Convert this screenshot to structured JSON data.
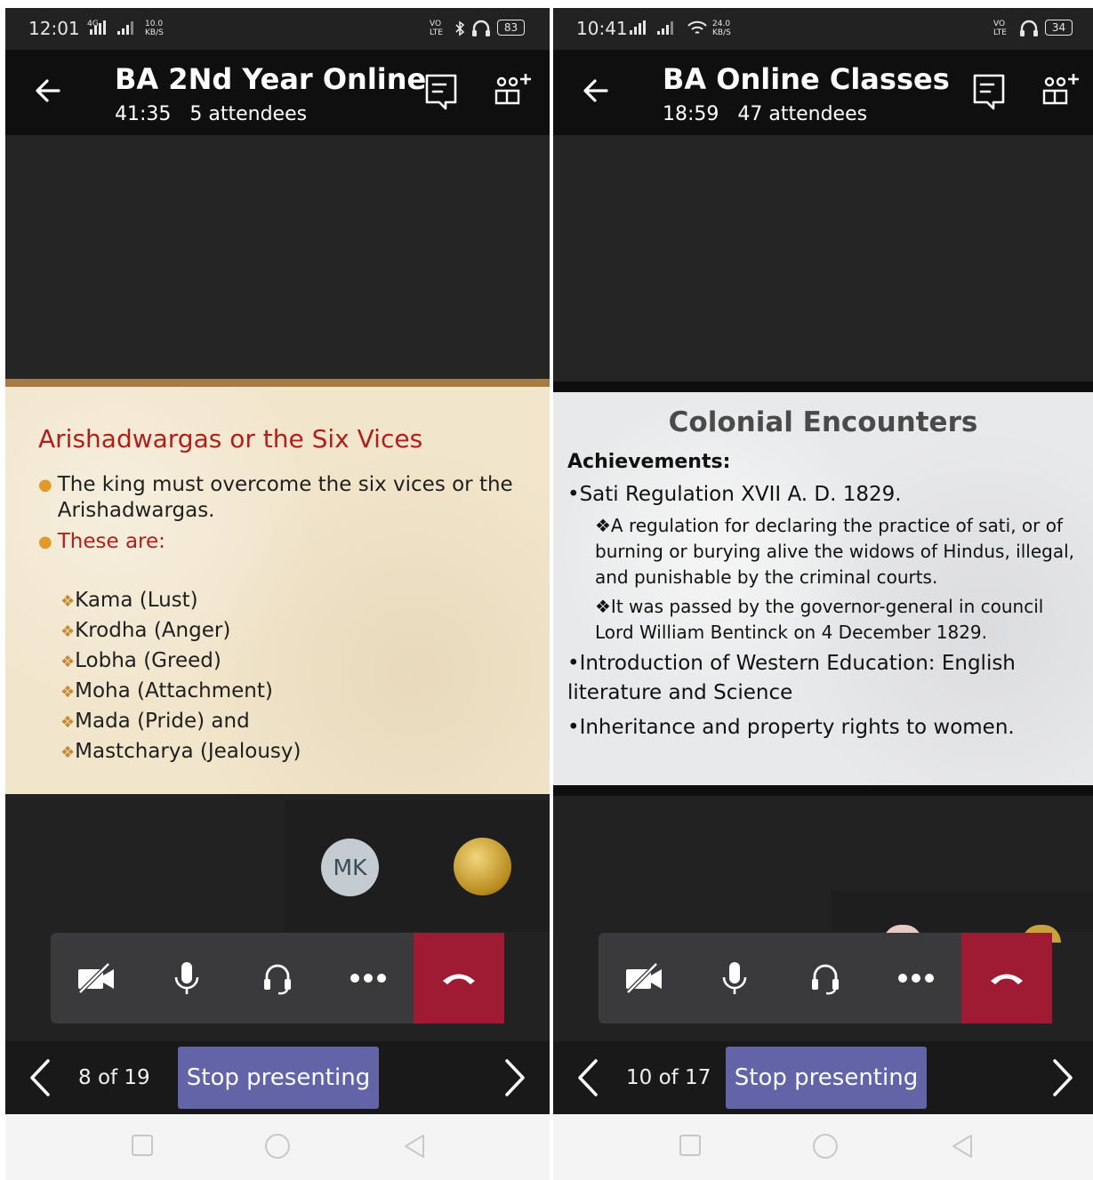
{
  "left_phone": {
    "status": {
      "time": "12:01",
      "net_label": "4G",
      "speed": "10.0",
      "speed_unit": "KB/S",
      "volte": "VO LTE",
      "battery": "83"
    },
    "header": {
      "title": "BA 2Nd Year Online",
      "timer": "41:35",
      "attendees": "5 attendees"
    },
    "slide": {
      "title": "Arishadwargas  or  the Six Vices",
      "bullet1": "The king must overcome the six vices or the Arishadwargas.",
      "bullet2": "These are:",
      "vices": [
        "Kama (Lust)",
        "Krodha (Anger)",
        "Lobha (Greed)",
        "Moha (Attachment)",
        "Mada (Pride) and",
        "Mastcharya (Jealousy)"
      ]
    },
    "avatar_initials": "MK",
    "presenter": {
      "count": "8 of 19",
      "stop_label": "Stop presenting"
    }
  },
  "right_phone": {
    "status": {
      "time": "10:41",
      "speed": "24.0",
      "speed_unit": "KB/S",
      "volte": "VO LTE",
      "battery": "34"
    },
    "header": {
      "title": "BA Online Classes",
      "timer": "18:59",
      "attendees": "47 attendees"
    },
    "slide": {
      "title": "Colonial Encounters",
      "heading": "Achievements:",
      "point1": "•Sati Regulation XVII A. D. 1829.",
      "sub1": "❖A regulation for declaring the practice of sati, or of burning or burying alive the widows of Hindus, illegal, and punishable by the criminal courts.",
      "sub2": "❖It was passed by the governor-general in council Lord William Bentinck on 4 December 1829.",
      "point2": "•Introduction of Western Education: English literature and Science",
      "point3": "•Inheritance and property rights to women."
    },
    "presenter": {
      "count": "10 of 17",
      "stop_label": "Stop presenting"
    }
  },
  "colors": {
    "hangup": "#9f1b33",
    "stop_button": "#6264a7",
    "slide_title_red": "#b0201a"
  },
  "icons": [
    "back-arrow-icon",
    "chat-icon",
    "add-people-icon",
    "camera-off-icon",
    "microphone-icon",
    "headset-icon",
    "more-icon",
    "hang-up-icon",
    "chevron-left-icon",
    "chevron-right-icon",
    "recents-icon",
    "home-icon",
    "back-nav-icon"
  ]
}
